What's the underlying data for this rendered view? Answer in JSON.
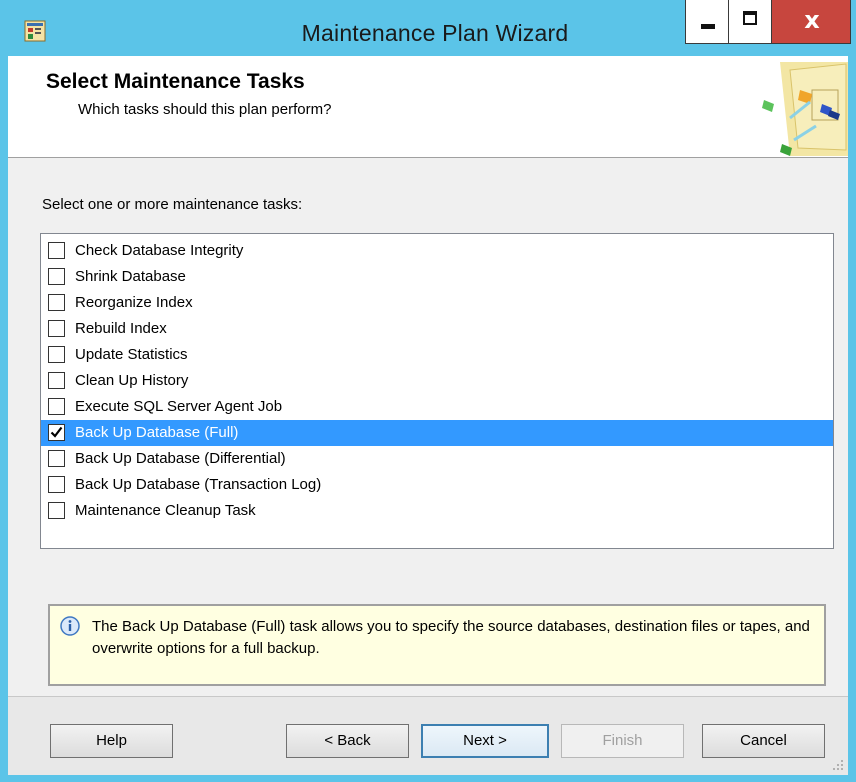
{
  "window": {
    "title": "Maintenance Plan Wizard",
    "close_glyph": "x"
  },
  "header": {
    "title": "Select Maintenance Tasks",
    "subtitle": "Which tasks should this plan perform?"
  },
  "instruction": "Select one or more maintenance tasks:",
  "tasks": [
    {
      "label": "Check Database Integrity",
      "checked": false,
      "selected": false
    },
    {
      "label": "Shrink Database",
      "checked": false,
      "selected": false
    },
    {
      "label": "Reorganize Index",
      "checked": false,
      "selected": false
    },
    {
      "label": "Rebuild Index",
      "checked": false,
      "selected": false
    },
    {
      "label": "Update Statistics",
      "checked": false,
      "selected": false
    },
    {
      "label": "Clean Up History",
      "checked": false,
      "selected": false
    },
    {
      "label": "Execute SQL Server Agent Job",
      "checked": false,
      "selected": false
    },
    {
      "label": "Back Up Database (Full)",
      "checked": true,
      "selected": true
    },
    {
      "label": "Back Up Database (Differential)",
      "checked": false,
      "selected": false
    },
    {
      "label": "Back Up Database (Transaction Log)",
      "checked": false,
      "selected": false
    },
    {
      "label": "Maintenance Cleanup Task",
      "checked": false,
      "selected": false
    }
  ],
  "description": "The Back Up Database (Full) task allows you to specify the source databases, destination files or tapes, and overwrite options for a full backup.",
  "buttons": {
    "help": "Help",
    "back": "< Back",
    "next": "Next >",
    "finish": "Finish",
    "cancel": "Cancel"
  },
  "colors": {
    "titlebar": "#5bc4e8",
    "close_button": "#c7463e",
    "selection": "#3399ff",
    "info_background": "#ffffe1"
  },
  "icons": [
    "app-icon",
    "wizard-graphic",
    "info-icon",
    "checkmark-icon"
  ]
}
